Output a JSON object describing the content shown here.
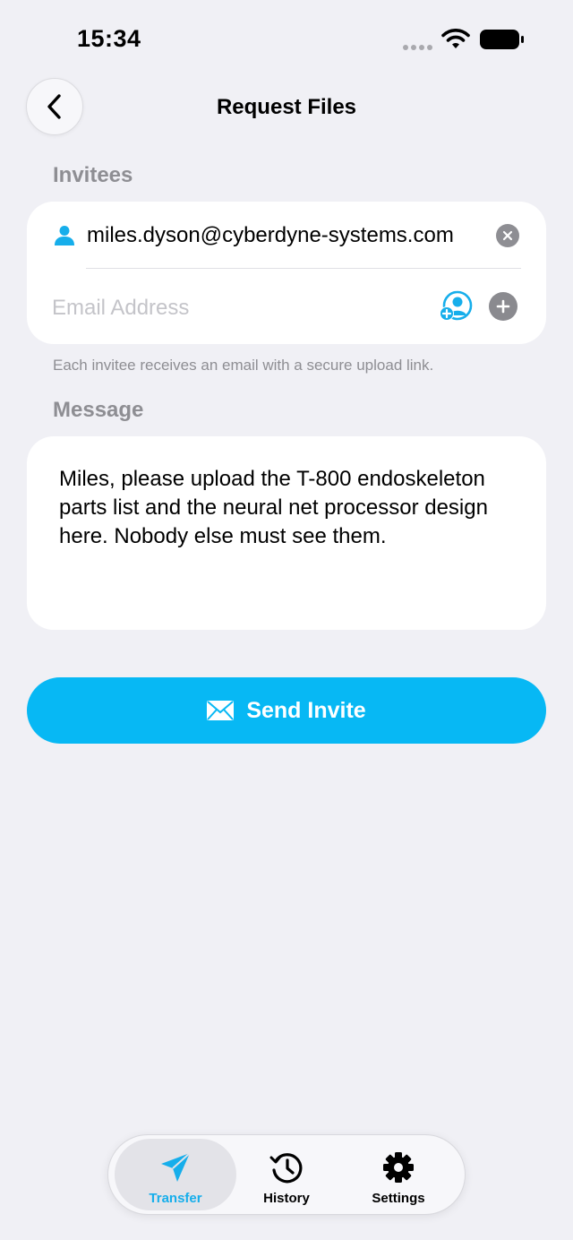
{
  "status_bar": {
    "time": "15:34"
  },
  "header": {
    "title": "Request Files"
  },
  "invitees": {
    "section_label": "Invitees",
    "items": [
      {
        "email": "miles.dyson@cyberdyne-systems.com"
      }
    ],
    "input_value": "",
    "input_placeholder": "Email Address",
    "helper_text": "Each invitee receives an email with a secure upload link."
  },
  "message": {
    "section_label": "Message",
    "text": "Miles, please upload the T-800 endoskeleton parts list and the neural net processor design here. Nobody else must see them."
  },
  "send_button": {
    "label": "Send Invite"
  },
  "tab_bar": {
    "tabs": [
      {
        "label": "Transfer",
        "icon": "paper-plane-icon",
        "active": true
      },
      {
        "label": "History",
        "icon": "history-icon",
        "active": false
      },
      {
        "label": "Settings",
        "icon": "gear-icon",
        "active": false
      }
    ]
  },
  "colors": {
    "accent": "#07B8F4",
    "background": "#F0F0F5",
    "card": "#FFFFFF",
    "secondary_text": "#8E8E93"
  }
}
